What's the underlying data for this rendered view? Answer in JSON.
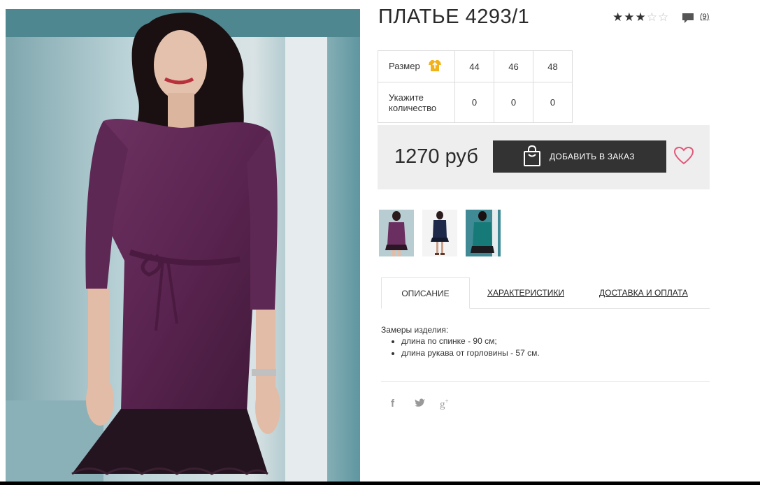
{
  "product": {
    "title": "ПЛАТЬЕ 4293/1",
    "rating": {
      "value": 3,
      "max": 5
    },
    "review_count": "(9)",
    "price": "1270 руб",
    "add_to_order_label": "ДОБАВИТЬ В ЗАКАЗ"
  },
  "size_table": {
    "size_label": "Размер",
    "sizes": [
      "44",
      "46",
      "48"
    ],
    "quantity_label_line1": "Укажите",
    "quantity_label_line2": "количество",
    "quantities": [
      "0",
      "0",
      "0"
    ]
  },
  "tabs": [
    {
      "label": "ОПИСАНИЕ",
      "active": true
    },
    {
      "label": "ХАРАКТЕРИСТИКИ",
      "active": false
    },
    {
      "label": "ДОСТАВКА И ОПЛАТА",
      "active": false
    }
  ],
  "description": {
    "title": "Замеры изделия:",
    "items": [
      "длина по спинке - 90 см;",
      "длина рукава от горловины - 57 см."
    ]
  },
  "thumbnails": [
    {
      "icon": "dress-purple-thumb",
      "color": "#5a2a4e"
    },
    {
      "icon": "dress-navy-thumb",
      "color": "#1f2a4a"
    },
    {
      "icon": "dress-teal-thumb",
      "color": "#167a78"
    }
  ],
  "social": [
    {
      "icon": "facebook-icon",
      "glyph": "f"
    },
    {
      "icon": "twitter-icon",
      "glyph": "🐦"
    },
    {
      "icon": "google-plus-icon",
      "glyph": "g+"
    }
  ],
  "colors": {
    "button_bg": "#333333",
    "heart": "#e05a7a",
    "price_box_bg": "#eeeeee",
    "size_icon": "#f2b21b"
  }
}
